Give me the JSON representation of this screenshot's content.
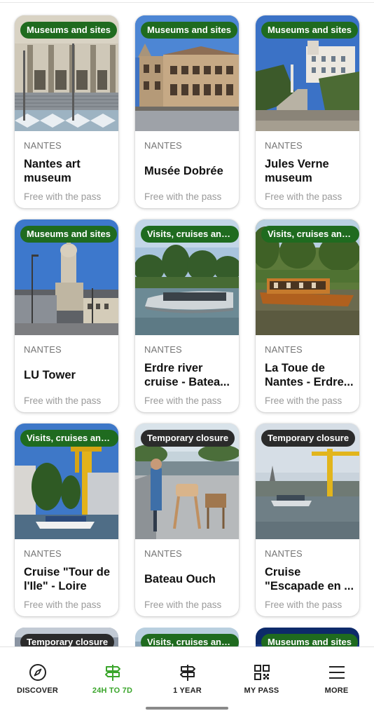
{
  "cards": [
    {
      "badge": "Museums and sites",
      "badge_color": "#1f6b1f",
      "city": "NANTES",
      "title": "Nantes art museum",
      "price": "Free with the pass",
      "image": "art-museum-photo"
    },
    {
      "badge": "Museums and sites",
      "badge_color": "#1f6b1f",
      "city": "NANTES",
      "title": "Musée Dobrée",
      "price": "Free with the pass",
      "image": "dobree-photo"
    },
    {
      "badge": "Museums and sites",
      "badge_color": "#1f6b1f",
      "city": "NANTES",
      "title": "Jules Verne museum",
      "price": "Free with the pass",
      "image": "jules-verne-photo"
    },
    {
      "badge": "Museums and sites",
      "badge_color": "#1f6b1f",
      "city": "NANTES",
      "title": "LU Tower",
      "price": "Free with the pass",
      "image": "lu-tower-photo"
    },
    {
      "badge": "Visits, cruises and ...",
      "badge_color": "#1f6b1f",
      "city": "NANTES",
      "title": "Erdre river cruise - Batea...",
      "price": "Free with the pass",
      "image": "erdre-cruise-photo"
    },
    {
      "badge": "Visits, cruises and ...",
      "badge_color": "#1f6b1f",
      "city": "NANTES",
      "title": "La Toue de Nantes - Erdre...",
      "price": "Free with the pass",
      "image": "toue-photo"
    },
    {
      "badge": "Visits, cruises and ...",
      "badge_color": "#1f6b1f",
      "city": "NANTES",
      "title": "Cruise \"Tour de l'Ile\" - Loire",
      "price": "Free with the pass",
      "image": "tour-ile-photo"
    },
    {
      "badge": "Temporary closure",
      "badge_color": "#2b2b2b",
      "city": "NANTES",
      "title": "Bateau Ouch",
      "price": "Free with the pass",
      "image": "bateau-ouch-photo"
    },
    {
      "badge": "Temporary closure",
      "badge_color": "#2b2b2b",
      "city": "NANTES",
      "title": "Cruise \"Escapade en ...",
      "price": "Free with the pass",
      "image": "escapade-photo"
    }
  ],
  "peek_cards": [
    {
      "badge": "Temporary closure",
      "badge_color": "#2b2b2b"
    },
    {
      "badge": "Visits, cruises and ...",
      "badge_color": "#1f6b1f"
    },
    {
      "badge": "Museums and sites",
      "badge_color": "#1f6b1f"
    }
  ],
  "nav": {
    "accent_color": "#3aa52b",
    "items": [
      {
        "label": "DISCOVER",
        "icon": "compass-icon",
        "active": false
      },
      {
        "label": "24H TO 7D",
        "icon": "signpost-icon",
        "active": true
      },
      {
        "label": "1 YEAR",
        "icon": "signpost-icon",
        "active": false
      },
      {
        "label": "MY PASS",
        "icon": "qr-code-icon",
        "active": false
      },
      {
        "label": "MORE",
        "icon": "menu-icon",
        "active": false
      }
    ]
  }
}
